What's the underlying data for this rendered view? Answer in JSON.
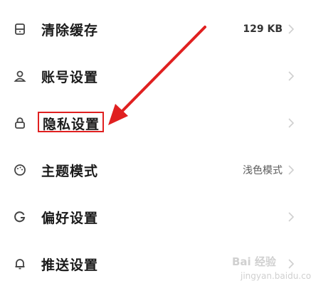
{
  "settings": {
    "items": [
      {
        "label": "清除缓存",
        "value": "129 KB",
        "icon": "storage-icon"
      },
      {
        "label": "账号设置",
        "value": "",
        "icon": "user-icon"
      },
      {
        "label": "隐私设置",
        "value": "",
        "icon": "lock-icon",
        "highlighted": true
      },
      {
        "label": "主题模式",
        "value": "浅色模式",
        "icon": "palette-icon"
      },
      {
        "label": "偏好设置",
        "value": "",
        "icon": "preference-icon"
      },
      {
        "label": "推送设置",
        "value": "",
        "icon": "bell-icon"
      }
    ]
  },
  "annotation": {
    "color": "#e02020"
  },
  "watermark": {
    "line1": "Bai 经验",
    "line2": "jingyan.baidu.com"
  }
}
